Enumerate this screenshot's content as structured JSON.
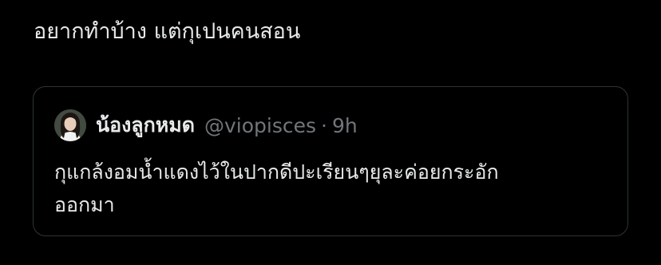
{
  "tweet": {
    "text": "อยากทำบ้าง แต่กุเปนคนสอน"
  },
  "quote": {
    "author_name": "น้องลูกหมด",
    "handle": "@viopisces",
    "separator": "·",
    "time": "9h",
    "text_line1": "กุแกล้งอมน้ำแดงไว้ในปากดีปะเรียนๆยุละค่อยกระอัก",
    "text_line2": "ออกมา"
  },
  "colors": {
    "background": "#000000",
    "text": "#e7e9ea",
    "secondary": "#71767b",
    "border": "#2f3336"
  }
}
